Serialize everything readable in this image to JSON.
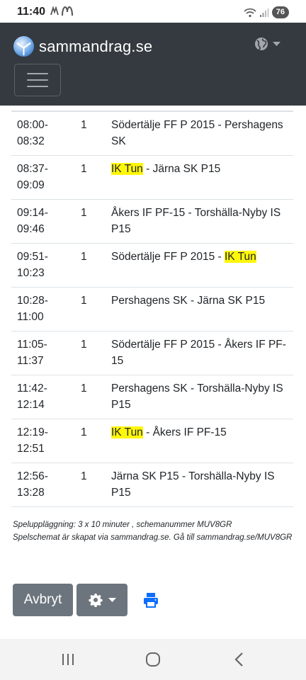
{
  "status_bar": {
    "time": "11:40",
    "battery": "76",
    "left_icons": [
      "brand-icon-1",
      "mcdonalds-icon"
    ],
    "right_icons": [
      "wifi-icon",
      "signal-icon",
      "battery-icon"
    ]
  },
  "navbar": {
    "brand": "sammandrag.se",
    "language_icon": "globe-icon",
    "menu_icon": "hamburger-icon",
    "background": "#343a40"
  },
  "schedule": {
    "rows": [
      {
        "time": "08:00-\n08:32",
        "field": "1",
        "match": [
          {
            "t": "Södertälje FF P 2015 - Pershagens SK",
            "hl": false
          }
        ]
      },
      {
        "time": "08:37-\n09:09",
        "field": "1",
        "match": [
          {
            "t": "IK Tun",
            "hl": true
          },
          {
            "t": " - Järna SK P15",
            "hl": false
          }
        ]
      },
      {
        "time": "09:14-\n09:46",
        "field": "1",
        "match": [
          {
            "t": "Åkers IF PF-15 - Torshälla-Nyby IS P15",
            "hl": false
          }
        ]
      },
      {
        "time": "09:51-\n10:23",
        "field": "1",
        "match": [
          {
            "t": "Södertälje FF P 2015 - ",
            "hl": false
          },
          {
            "t": "IK Tun",
            "hl": true
          }
        ]
      },
      {
        "time": "10:28-\n11:00",
        "field": "1",
        "match": [
          {
            "t": "Pershagens SK - Järna SK P15",
            "hl": false
          }
        ]
      },
      {
        "time": "11:05-\n11:37",
        "field": "1",
        "match": [
          {
            "t": "Södertälje FF P 2015 - Åkers IF PF-15",
            "hl": false
          }
        ]
      },
      {
        "time": "11:42-\n12:14",
        "field": "1",
        "match": [
          {
            "t": "Pershagens SK - Torshälla-Nyby IS P15",
            "hl": false
          }
        ]
      },
      {
        "time": "12:19-\n12:51",
        "field": "1",
        "match": [
          {
            "t": "IK Tun",
            "hl": true
          },
          {
            "t": " - Åkers IF PF-15",
            "hl": false
          }
        ]
      },
      {
        "time": "12:56-\n13:28",
        "field": "1",
        "match": [
          {
            "t": "Järna SK P15 - Torshälla-Nyby IS P15",
            "hl": false
          }
        ]
      }
    ],
    "highlight_color": "#fff70a"
  },
  "notes": {
    "line1": "Speluppläggning: 3 x 10 minuter , schemanummer MUV8GR",
    "line2": "Spelschemat är skapat via sammandrag.se. Gå till sammandrag.se/MUV8GR"
  },
  "actions": {
    "cancel_label": "Avbryt",
    "settings_icon": "gear-icon",
    "print_icon": "printer-icon",
    "button_color": "#6c757d",
    "print_color": "#0d6efd"
  },
  "android_nav": {
    "icons": [
      "recents-icon",
      "home-icon",
      "back-icon"
    ]
  }
}
